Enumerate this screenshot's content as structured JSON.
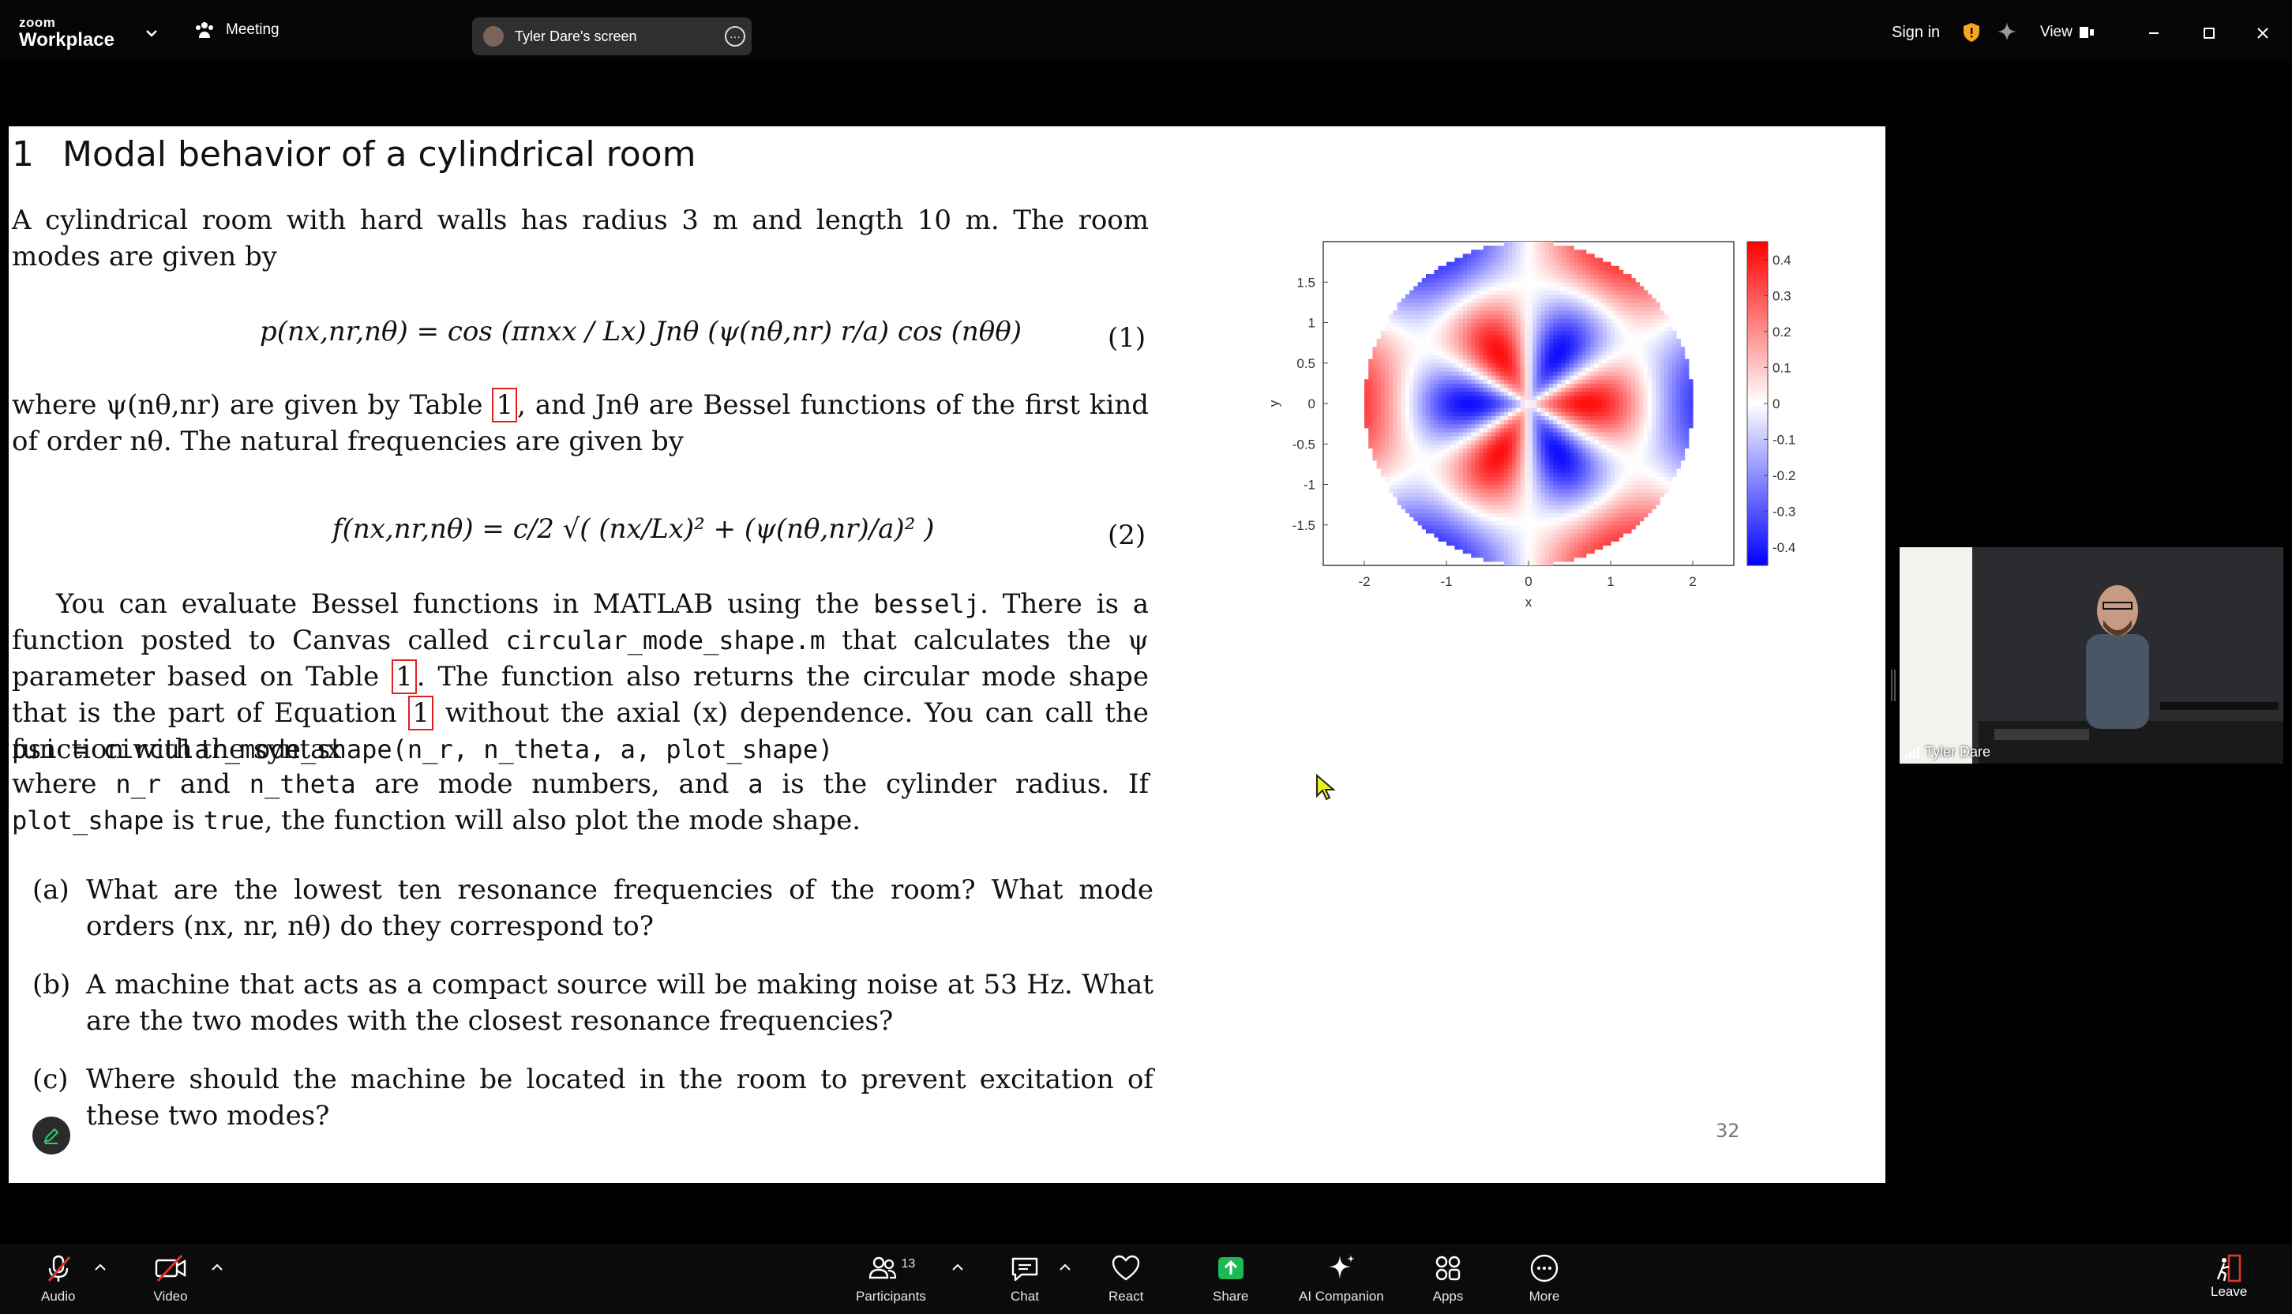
{
  "app": {
    "brand_small": "zoom",
    "brand_large": "Workplace",
    "meeting_label": "Meeting",
    "shared_screen_label": "Tyler Dare's screen",
    "sign_in": "Sign in",
    "view": "View"
  },
  "slide": {
    "section_number": "1",
    "title": "Modal behavior of a cylindrical room",
    "intro": "A cylindrical room with hard walls has radius 3 m and length 10 m. The room modes are given by",
    "eq1_lhs": "p(nx,nr,nθ) = cos",
    "eq1_mid": "(πnxx / Lx) Jnθ (ψ(nθ,nr) r/a) cos (nθθ)",
    "eq1_number": "(1)",
    "para2_a": "where ψ(nθ,nr) are given by Table",
    "ref_table_1": "1",
    "para2_b": ", and Jnθ are Bessel functions of the first kind of order nθ. The natural frequencies are given by",
    "eq2_lhs": "f(nx,nr,nθ) =",
    "eq2_rhs": "c/2 √( (nx/Lx)² + (ψ(nθ,nr)/a)² )",
    "eq2_number": "(2)",
    "para3_a": "You can evaluate Bessel functions in MATLAB using the",
    "code_besselj": "besselj",
    "para3_b": ". There is a function posted to Canvas called",
    "code_file": "circular_mode_shape.m",
    "para3_c": "that calculates the ψ parameter based on Table",
    "para3_d": ". The function also returns the circular mode shape that is the part of Equation",
    "ref_eq_1": "1",
    "para3_e": "without the axial (x) dependence. You can call the function with the syntax",
    "code_call": "psi = circular_mode_shape(n_r, n_theta, a, plot_shape)",
    "para4_a": "where",
    "code_nr": "n_r",
    "para4_b": "and",
    "code_ntheta": "n_theta",
    "para4_c": "are mode numbers, and",
    "code_a": "a",
    "para4_d": "is the cylinder radius. If",
    "code_plot": "plot_shape",
    "para4_e": "is",
    "code_true": "true",
    "para4_f": ", the function will also plot the mode shape.",
    "questions": [
      {
        "label": "(a)",
        "text": "What are the lowest ten resonance frequencies of the room?  What mode orders (nx, nr, nθ) do they correspond to?"
      },
      {
        "label": "(b)",
        "text": "A machine that acts as a compact source will be making noise at 53 Hz.  What are the two modes with the closest resonance frequencies?"
      },
      {
        "label": "(c)",
        "text": "Where should the machine be located in the room to prevent excitation of these two modes?"
      }
    ],
    "page_number": "32"
  },
  "chart_data": {
    "type": "heatmap",
    "title": "",
    "xlabel": "x",
    "ylabel": "y",
    "xlim": [
      -2.5,
      2.5
    ],
    "ylim": [
      -2,
      2
    ],
    "x_ticks": [
      "-2",
      "-1",
      "0",
      "1",
      "2"
    ],
    "y_ticks": [
      "1.5",
      "1",
      "0.5",
      "0",
      "-0.5",
      "-1",
      "-1.5"
    ],
    "colorbar_ticks": [
      "0.4",
      "0.3",
      "0.2",
      "0.1",
      "0",
      "-0.1",
      "-0.2",
      "-0.3",
      "-0.4"
    ],
    "colorbar_range": [
      -0.45,
      0.45
    ],
    "colormap": [
      "#0000ff",
      "#ffffff",
      "#ff0000"
    ],
    "field": {
      "domain": "disk",
      "radius": 2,
      "n_theta": 3,
      "lobes": 6
    }
  },
  "participant": {
    "name": "Tyler Dare"
  },
  "toolbar": {
    "audio": "Audio",
    "video": "Video",
    "participants": "Participants",
    "participants_count": "13",
    "chat": "Chat",
    "react": "React",
    "share": "Share",
    "ai_companion": "AI Companion",
    "apps": "Apps",
    "more": "More",
    "leave": "Leave"
  },
  "colors": {
    "share_green": "#1db954",
    "mute_red": "#e0352b",
    "ref_box": "#e02020"
  }
}
